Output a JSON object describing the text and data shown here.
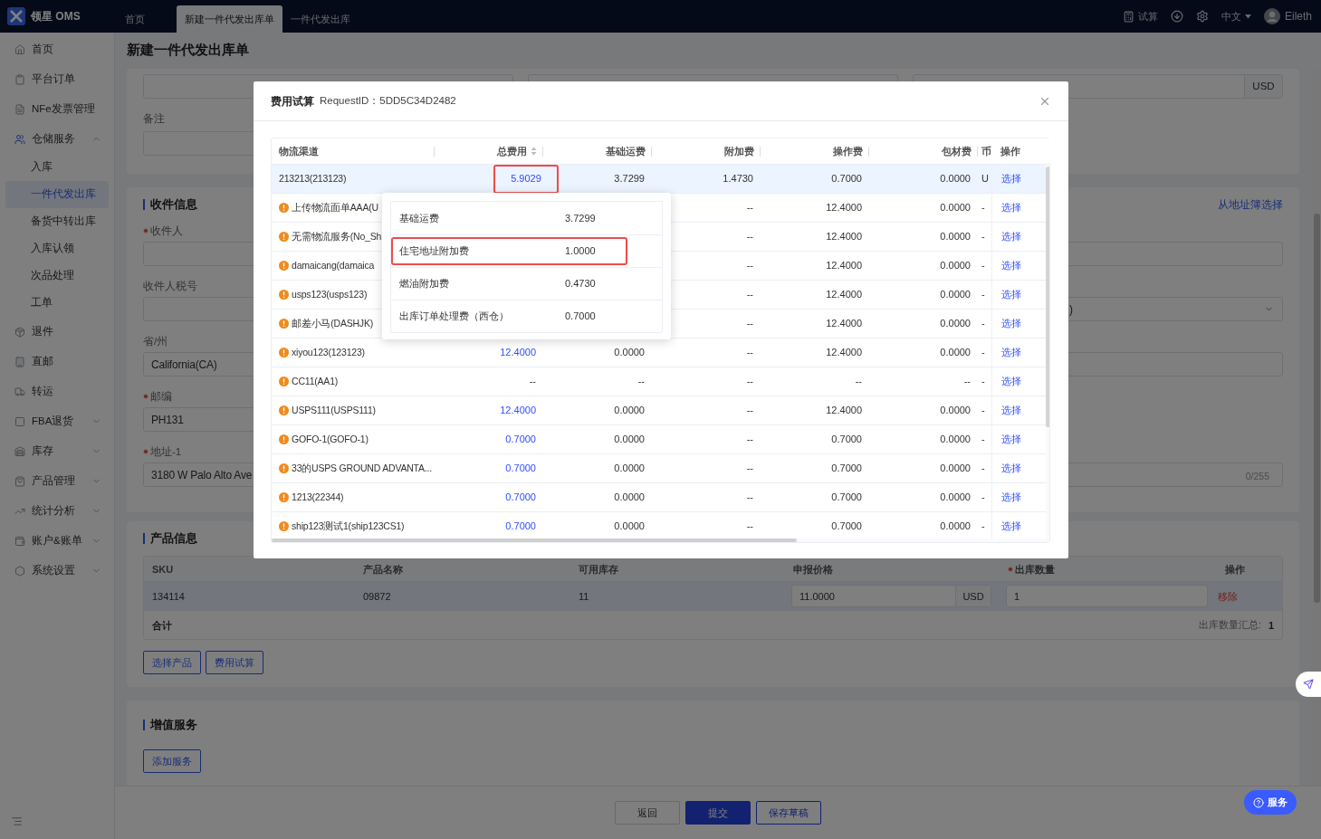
{
  "topbar": {
    "logo_text": "领星 OMS",
    "tabs": [
      {
        "label": "首页",
        "selected": false
      },
      {
        "label": "新建一件代发出库单",
        "selected": true
      },
      {
        "label": "一件代发出库",
        "selected": false
      }
    ],
    "calc_label": "试算",
    "language": "中文",
    "user": "Eileth"
  },
  "sidebar": {
    "items": [
      {
        "label": "首页",
        "kind": "link"
      },
      {
        "label": "平台订单",
        "kind": "link"
      },
      {
        "label": "NFe发票管理",
        "kind": "link"
      },
      {
        "label": "仓储服务",
        "kind": "group",
        "expanded": true,
        "children": [
          {
            "label": "入库",
            "selected": false
          },
          {
            "label": "一件代发出库",
            "selected": true
          },
          {
            "label": "备货中转出库",
            "selected": false
          },
          {
            "label": "入库认领",
            "selected": false
          },
          {
            "label": "次品处理",
            "selected": false
          },
          {
            "label": "工单",
            "selected": false
          }
        ]
      },
      {
        "label": "退件",
        "kind": "link"
      },
      {
        "label": "直邮",
        "kind": "link"
      },
      {
        "label": "转运",
        "kind": "link"
      },
      {
        "label": "FBA退货",
        "kind": "group",
        "expanded": false
      },
      {
        "label": "库存",
        "kind": "group",
        "expanded": false
      },
      {
        "label": "产品管理",
        "kind": "group",
        "expanded": false
      },
      {
        "label": "统计分析",
        "kind": "group",
        "expanded": false
      },
      {
        "label": "账户&账单",
        "kind": "group",
        "expanded": false
      },
      {
        "label": "系统设置",
        "kind": "group",
        "expanded": false
      }
    ]
  },
  "page": {
    "title": "新建一件代发出库单",
    "top_card": {
      "currency": "USD",
      "remark_label": "备注"
    },
    "recipient": {
      "title": "收件信息",
      "address_book_link": "从地址簿选择",
      "rows": [
        {
          "label": "收件人",
          "required": true,
          "right": {
            "kind": "input"
          }
        },
        {
          "label": "收件人税号",
          "required": false,
          "right": {
            "kind": "select",
            "value": ")"
          }
        },
        {
          "label": "省/州",
          "required": false,
          "value": "California(CA)",
          "right": {
            "kind": "input"
          }
        },
        {
          "label": "邮编",
          "required": true,
          "value": "PH131",
          "right": {
            "kind": "none"
          }
        },
        {
          "label": "地址-1",
          "required": true,
          "value": "3180 W Palo Alto Ave",
          "right": {
            "kind": "textarea",
            "counter": "0/255"
          }
        }
      ]
    },
    "products": {
      "title": "产品信息",
      "columns": [
        {
          "label": "SKU",
          "required": false
        },
        {
          "label": "产品名称",
          "required": false
        },
        {
          "label": "可用库存",
          "required": false
        },
        {
          "label": "申报价格",
          "required": false
        },
        {
          "label": "出库数量",
          "required": true
        },
        {
          "label": "操作",
          "required": false
        }
      ],
      "rows": [
        {
          "sku": "134114",
          "name": "09872",
          "stock": "11",
          "price": "11.0000",
          "price_currency": "USD",
          "qty": "1",
          "action": "移除",
          "selected": true
        }
      ],
      "total_label": "合计",
      "qty_sum_label": "出库数量汇总:",
      "qty_sum": "1",
      "buttons": [
        "选择产品",
        "费用试算"
      ]
    },
    "value_added": {
      "title": "增值服务",
      "button": "添加服务"
    },
    "footer_buttons": [
      {
        "label": "返回",
        "kind": "default"
      },
      {
        "label": "提交",
        "kind": "primary"
      },
      {
        "label": "保存草稿",
        "kind": "outline"
      }
    ]
  },
  "service_button": "服务",
  "modal": {
    "title": "费用试算",
    "request": "RequestID：5DD5C34D2482",
    "columns": [
      "物流渠道",
      "总费用",
      "基础运费",
      "附加费",
      "操作费",
      "包材费",
      "币",
      "操作"
    ],
    "rows": [
      {
        "channel": "213213(213123)",
        "warning": false,
        "selected": true,
        "total": "5.9029",
        "total_link": true,
        "total_highlighted": true,
        "base": "3.7299",
        "surcharge": "1.4730",
        "operation": "0.7000",
        "packing": "0.0000",
        "currency": "U",
        "action": "选择"
      },
      {
        "channel": "上传物流面单AAA(U",
        "warning": true,
        "selected": false,
        "surcharge": "--",
        "operation": "12.4000",
        "packing": "0.0000",
        "currency": "-",
        "action": "选择"
      },
      {
        "channel": "无需物流服务(No_Sh",
        "warning": true,
        "selected": false,
        "surcharge": "--",
        "operation": "12.4000",
        "packing": "0.0000",
        "currency": "-",
        "action": "选择"
      },
      {
        "channel": "damaicang(damaica",
        "warning": true,
        "selected": false,
        "surcharge": "--",
        "operation": "12.4000",
        "packing": "0.0000",
        "currency": "-",
        "action": "选择"
      },
      {
        "channel": "usps123(usps123)",
        "warning": true,
        "selected": false,
        "surcharge": "--",
        "operation": "12.4000",
        "packing": "0.0000",
        "currency": "-",
        "action": "选择"
      },
      {
        "channel": "邮差小马(DASHJK)",
        "warning": true,
        "selected": false,
        "surcharge": "--",
        "operation": "12.4000",
        "packing": "0.0000",
        "currency": "-",
        "action": "选择"
      },
      {
        "channel": "xiyou123(123123)",
        "warning": true,
        "selected": false,
        "total": "12.4000",
        "total_link": true,
        "total_highlighted": false,
        "base": "0.0000",
        "surcharge": "--",
        "operation": "12.4000",
        "packing": "0.0000",
        "currency": "-",
        "action": "选择"
      },
      {
        "channel": "CC11(AA1)",
        "warning": true,
        "selected": false,
        "total": "--",
        "total_link": false,
        "total_highlighted": false,
        "base": "--",
        "surcharge": "--",
        "operation": "--",
        "packing": "--",
        "currency": "-",
        "action": "选择"
      },
      {
        "channel": "USPS111(USPS111)",
        "warning": true,
        "selected": false,
        "total": "12.4000",
        "total_link": true,
        "total_highlighted": false,
        "base": "0.0000",
        "surcharge": "--",
        "operation": "12.4000",
        "packing": "0.0000",
        "currency": "-",
        "action": "选择"
      },
      {
        "channel": "GOFO-1(GOFO-1)",
        "warning": true,
        "selected": false,
        "total": "0.7000",
        "total_link": true,
        "total_highlighted": false,
        "base": "0.0000",
        "surcharge": "--",
        "operation": "0.7000",
        "packing": "0.0000",
        "currency": "-",
        "action": "选择"
      },
      {
        "channel": "33的USPS GROUND ADVANTA...",
        "warning": true,
        "selected": false,
        "total": "0.7000",
        "total_link": true,
        "total_highlighted": false,
        "base": "0.0000",
        "surcharge": "--",
        "operation": "0.7000",
        "packing": "0.0000",
        "currency": "-",
        "action": "选择"
      },
      {
        "channel": "1213(22344)",
        "warning": true,
        "selected": false,
        "total": "0.7000",
        "total_link": true,
        "total_highlighted": false,
        "base": "0.0000",
        "surcharge": "--",
        "operation": "0.7000",
        "packing": "0.0000",
        "currency": "-",
        "action": "选择"
      },
      {
        "channel": "ship123测试1(ship123CS1)",
        "warning": true,
        "selected": false,
        "total": "0.7000",
        "total_link": true,
        "total_highlighted": false,
        "base": "0.0000",
        "surcharge": "--",
        "operation": "0.7000",
        "packing": "0.0000",
        "currency": "-",
        "action": "选择"
      }
    ],
    "breakdown": {
      "items": [
        {
          "label": "基础运费",
          "value": "3.7299",
          "highlighted": false
        },
        {
          "label": "住宅地址附加费",
          "value": "1.0000",
          "highlighted": true
        },
        {
          "label": "燃油附加费",
          "value": "0.4730",
          "highlighted": false
        },
        {
          "label": "出库订单处理费（西仓）",
          "value": "0.7000",
          "highlighted": false
        }
      ]
    }
  }
}
